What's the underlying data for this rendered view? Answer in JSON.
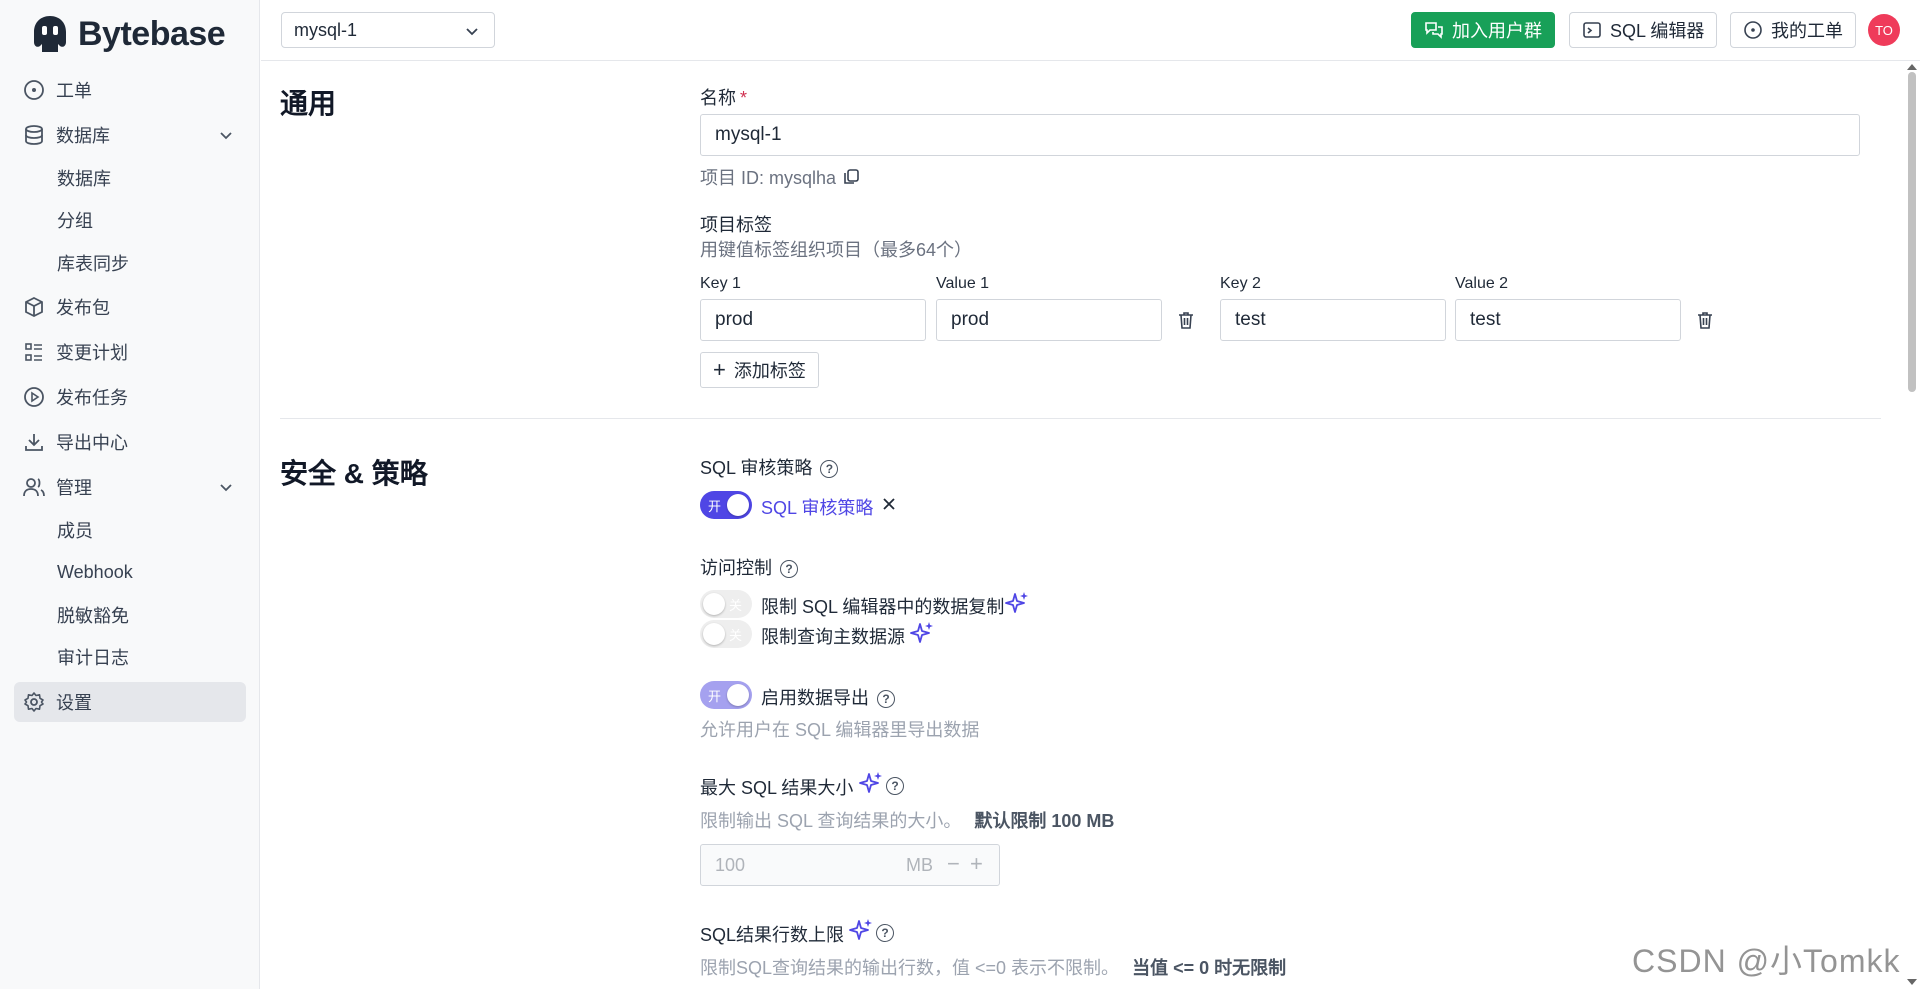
{
  "app": {
    "logo_text": "Bytebase"
  },
  "sidebar": {
    "items": [
      {
        "label": "工单"
      },
      {
        "label": "数据库"
      },
      {
        "label": "数据库"
      },
      {
        "label": "分组"
      },
      {
        "label": "库表同步"
      },
      {
        "label": "发布包"
      },
      {
        "label": "变更计划"
      },
      {
        "label": "发布任务"
      },
      {
        "label": "导出中心"
      },
      {
        "label": "管理"
      },
      {
        "label": "成员"
      },
      {
        "label": "Webhook"
      },
      {
        "label": "脱敏豁免"
      },
      {
        "label": "审计日志"
      },
      {
        "label": "设置"
      }
    ]
  },
  "header": {
    "project_select": "mysql-1",
    "join_group": "加入用户群",
    "sql_editor": "SQL 编辑器",
    "my_issues": "我的工单",
    "avatar": "TO"
  },
  "general": {
    "title": "通用",
    "name_label": "名称",
    "required_mark": "*",
    "name_value": "mysql-1",
    "project_id": "项目 ID: mysqlha",
    "labels_title": "项目标签",
    "labels_desc": "用键值标签组织项目（最多64个）",
    "pairs": [
      {
        "key_label": "Key 1",
        "value_label": "Value 1",
        "key": "prod",
        "value": "prod"
      },
      {
        "key_label": "Key 2",
        "value_label": "Value 2",
        "key": "test",
        "value": "test"
      }
    ],
    "add_label": "添加标签"
  },
  "security": {
    "title": "安全 & 策略",
    "sql_review_title": "SQL 审核策略",
    "sql_review_toggle_text": "开",
    "sql_review_link": "SQL 审核策略",
    "access_title": "访问控制",
    "restrict_copy": "限制 SQL 编辑器中的数据复制",
    "restrict_datasource": "限制查询主数据源",
    "off_text": "关",
    "export_toggle_text": "开",
    "export_title": "启用数据导出",
    "export_desc": "允许用户在 SQL 编辑器里导出数据",
    "max_size_title": "最大 SQL 结果大小",
    "max_size_desc": "限制输出 SQL 查询结果的大小。",
    "max_size_default": "默认限制 100 MB",
    "max_size_value": "100",
    "max_size_unit": "MB",
    "row_limit_title": "SQL结果行数上限",
    "row_limit_desc": "限制SQL查询结果的输出行数，值 <=0 表示不限制。",
    "row_limit_note": "当值 <= 0 时无限制"
  },
  "watermark": "CSDN @小Tomkk",
  "colors": {
    "accent": "#4f46e5",
    "green": "#18a058",
    "avatar": "#ef3b5a"
  }
}
